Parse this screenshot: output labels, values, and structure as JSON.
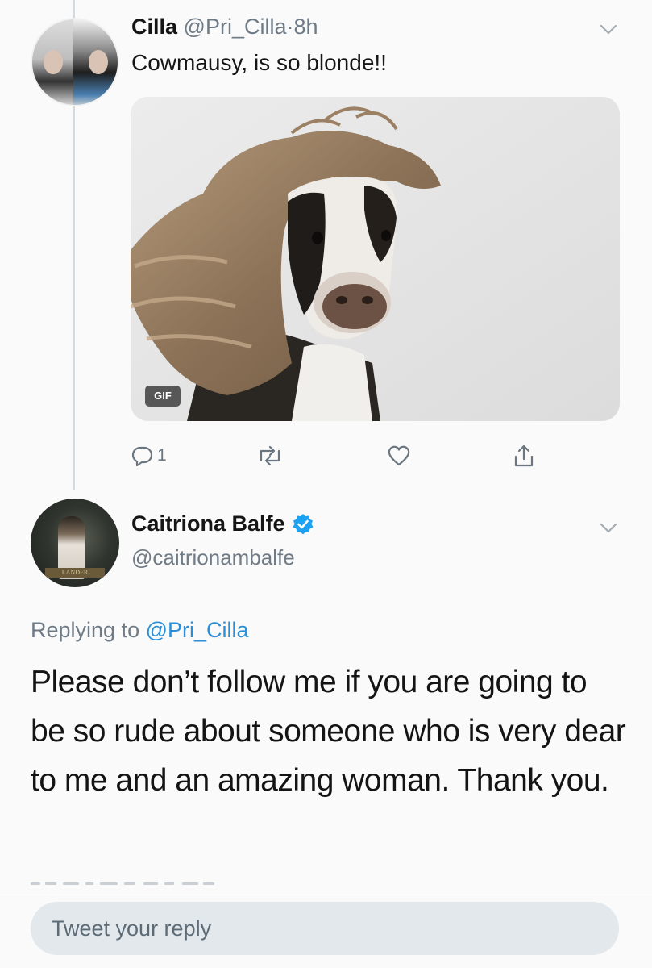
{
  "tweet1": {
    "name": "Cilla",
    "handle": "@Pri_Cilla",
    "separator": "·",
    "time": "8h",
    "text": "Cowmausy, is so blonde!!",
    "media_badge": "GIF",
    "actions": {
      "reply_count": "1",
      "reply_icon": "reply-icon",
      "retweet_icon": "retweet-icon",
      "like_icon": "heart-icon",
      "share_icon": "share-icon"
    }
  },
  "tweet2": {
    "name": "Caitriona Balfe",
    "verified": true,
    "handle": "@caitrionambalfe",
    "replying_prefix": "Replying to",
    "replying_to": "@Pri_Cilla",
    "text": "Please don’t follow me if you are going to be so rude about someone who is very dear to me and an amazing woman. Thank you.",
    "avatar_banner": "LANDER"
  },
  "composer": {
    "placeholder": "Tweet your reply"
  },
  "colors": {
    "link": "#2a8fd6",
    "verified": "#1da1f2",
    "muted": "#6f7b86",
    "reply_box": "#e3e8ec"
  }
}
